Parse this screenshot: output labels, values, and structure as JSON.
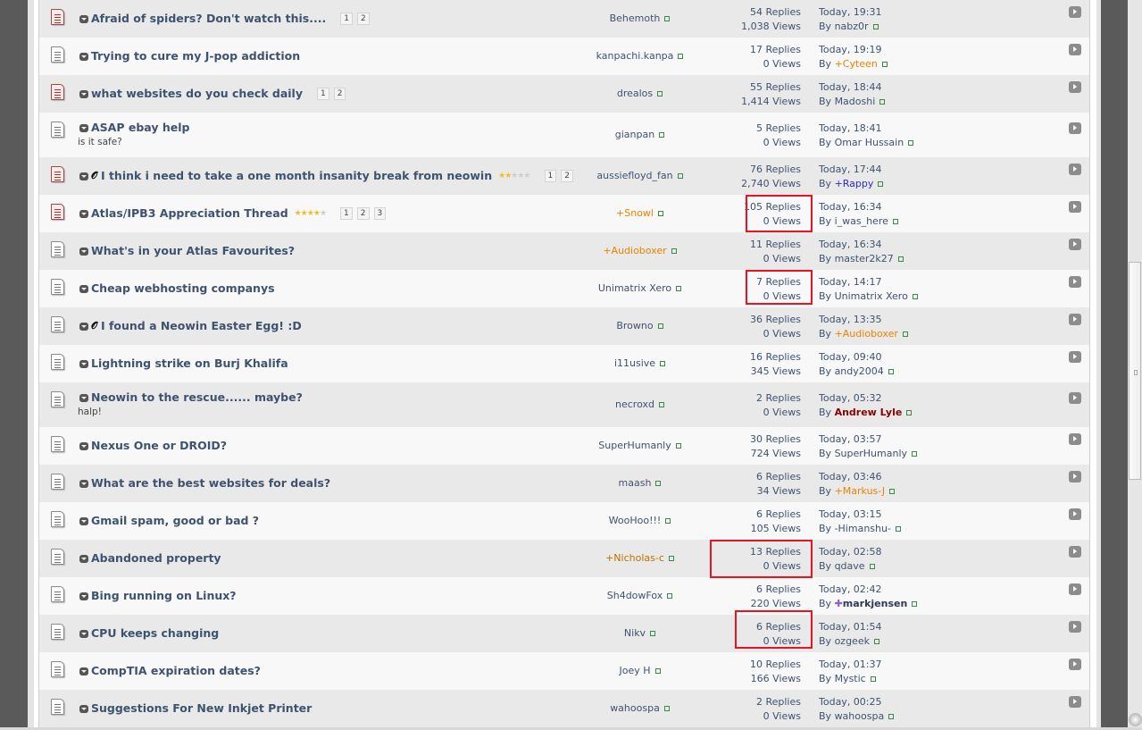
{
  "topics": [
    {
      "title": "Afraid of spiders? Don't watch this....",
      "hot": true,
      "pages": [
        "1",
        "2"
      ],
      "starter": "Behemoth",
      "starter_color": "#3e5370",
      "replies": "54 Replies",
      "views": "1,038 Views",
      "last_date": "Today, 19:31",
      "last_by": "nabz0r",
      "last_color": "#3e5370"
    },
    {
      "title": "Trying to cure my J-pop addiction",
      "starter": "kanpachi.kanpa",
      "starter_color": "#3e5370",
      "replies": "17 Replies",
      "views": "0 Views",
      "last_date": "Today, 19:19",
      "last_by": "+Cyteen",
      "last_color": "#f08000"
    },
    {
      "title": "what websites do you check daily",
      "hot": true,
      "pages": [
        "1",
        "2"
      ],
      "starter": "drealos",
      "starter_color": "#3e5370",
      "replies": "55 Replies",
      "views": "1,414 Views",
      "last_date": "Today, 18:44",
      "last_by": "Madoshi",
      "last_color": "#3e5370"
    },
    {
      "title": "ASAP ebay help",
      "desc": "is it safe?",
      "starter": "gianpan",
      "starter_color": "#3e5370",
      "replies": "5 Replies",
      "views": "0 Views",
      "last_date": "Today, 18:41",
      "last_by": "Omar Hussain",
      "last_color": "#3e5370"
    },
    {
      "title": "I think i need to take a one month insanity break from neowin",
      "hot": true,
      "attach": true,
      "rating": 2,
      "pages": [
        "1",
        "2"
      ],
      "starter": "aussiefloyd_fan",
      "starter_color": "#3e5370",
      "replies": "76 Replies",
      "views": "2,740 Views",
      "last_date": "Today, 17:44",
      "last_by": "+Rappy",
      "last_color": "#2a2ad8"
    },
    {
      "title": "Atlas/IPB3 Appreciation Thread",
      "hot": true,
      "rating": 4,
      "pages": [
        "1",
        "2",
        "3"
      ],
      "starter": "+Snowl",
      "starter_color": "#f08000",
      "replies": "105 Replies",
      "views": "0 Views",
      "last_date": "Today, 16:34",
      "last_by": "i_was_here",
      "last_color": "#3e5370"
    },
    {
      "title": "What's in your Atlas Favourites?",
      "starter": "+Audioboxer",
      "starter_color": "#f08000",
      "replies": "11 Replies",
      "views": "0 Views",
      "last_date": "Today, 16:34",
      "last_by": "master2k27",
      "last_color": "#3e5370"
    },
    {
      "title": "Cheap webhosting companys",
      "starter": "Unimatrix Xero",
      "starter_color": "#3e5370",
      "replies": "7 Replies",
      "views": "0 Views",
      "last_date": "Today, 14:17",
      "last_by": "Unimatrix Xero",
      "last_color": "#3e5370"
    },
    {
      "title": "I found a Neowin Easter Egg! :D",
      "attach": true,
      "starter": "Browno",
      "starter_color": "#3e5370",
      "replies": "36 Replies",
      "views": "0 Views",
      "last_date": "Today, 13:35",
      "last_by": "+Audioboxer",
      "last_color": "#f08000"
    },
    {
      "title": "Lightning strike on Burj Khalifa",
      "starter": "i11usive",
      "starter_color": "#3e5370",
      "replies": "16 Replies",
      "views": "345 Views",
      "last_date": "Today, 09:40",
      "last_by": "andy2004",
      "last_color": "#3e5370"
    },
    {
      "title": "Neowin to the rescue...... maybe?",
      "desc": "halp!",
      "starter": "necroxd",
      "starter_color": "#3e5370",
      "replies": "2 Replies",
      "views": "0 Views",
      "last_date": "Today, 05:32",
      "last_by": "Andrew Lyle",
      "last_color": "#8b0000",
      "last_bold": true
    },
    {
      "title": "Nexus One or DROID?",
      "starter": "SuperHumanly",
      "starter_color": "#3e5370",
      "replies": "30 Replies",
      "views": "724 Views",
      "last_date": "Today, 03:57",
      "last_by": "SuperHumanly",
      "last_color": "#3e5370"
    },
    {
      "title": "What are the best websites for deals?",
      "starter": "maash",
      "starter_color": "#3e5370",
      "replies": "6 Replies",
      "views": "34 Views",
      "last_date": "Today, 03:46",
      "last_by": "+Markus-J",
      "last_color": "#f08000"
    },
    {
      "title": "Gmail spam, good or bad ?",
      "starter": "WooHoo!!!",
      "starter_color": "#3e5370",
      "replies": "6 Replies",
      "views": "105 Views",
      "last_date": "Today, 03:15",
      "last_by": "-Himanshu-",
      "last_color": "#3e5370"
    },
    {
      "title": "Abandoned property",
      "starter": "+Nicholas-c",
      "starter_color": "#c07000",
      "replies": "13 Replies",
      "views": "0 Views",
      "last_date": "Today, 02:58",
      "last_by": "qdave",
      "last_color": "#3e5370"
    },
    {
      "title": "Bing running on Linux?",
      "starter": "Sh4dowFox",
      "starter_color": "#3e5370",
      "replies": "6 Replies",
      "views": "220 Views",
      "last_date": "Today, 02:42",
      "last_by": "markjensen",
      "last_color": "#2c3a55",
      "last_bold": true,
      "last_badge": true
    },
    {
      "title": "CPU keeps changing",
      "starter": "Nikv",
      "starter_color": "#3e5370",
      "replies": "6 Replies",
      "views": "0 Views",
      "last_date": "Today, 01:54",
      "last_by": "ozgeek",
      "last_color": "#3e5370"
    },
    {
      "title": "CompTIA expiration dates?",
      "starter": "Joey H",
      "starter_color": "#3e5370",
      "replies": "10 Replies",
      "views": "166 Views",
      "last_date": "Today, 01:37",
      "last_by": "Mystic",
      "last_color": "#3e5370"
    },
    {
      "title": "Suggestions For New Inkjet Printer",
      "starter": "wahoospa",
      "starter_color": "#3e5370",
      "replies": "2 Replies",
      "views": "0 Views",
      "last_date": "Today, 00:25",
      "last_by": "wahoospa",
      "last_color": "#3e5370"
    }
  ],
  "by_label": "By",
  "attach_icon": "paperclip-icon",
  "colors": {
    "highlight": "#e8141e"
  }
}
